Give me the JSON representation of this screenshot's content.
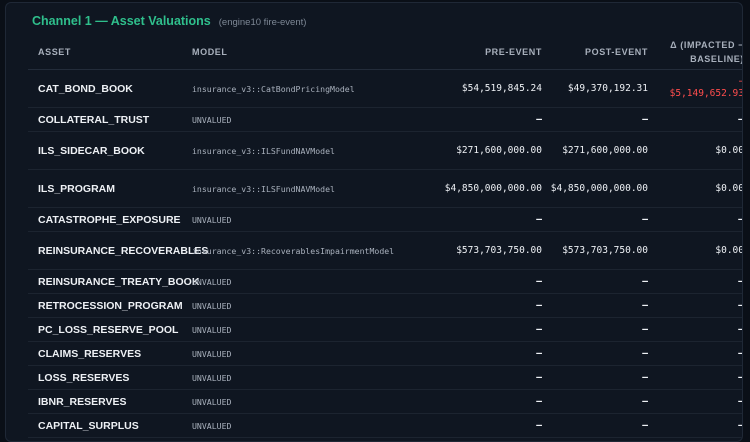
{
  "header": {
    "title": "Channel 1 — Asset Valuations",
    "subtitle": "(engine10 fire-event)"
  },
  "columns": {
    "asset": "ASSET",
    "model": "MODEL",
    "pre": "PRE-EVENT",
    "post": "POST-EVENT",
    "delta_line1": "Δ (IMPACTED −",
    "delta_line2": "BASELINE)"
  },
  "rows": [
    {
      "asset": "CAT_BOND_BOOK",
      "model": "insurance_v3::CatBondPricingModel",
      "pre": "$54,519,845.24",
      "post": "$49,370,192.31",
      "delta_prefix": "−",
      "delta": "$5,149,652.93",
      "negative": true
    },
    {
      "asset": "COLLATERAL_TRUST",
      "model": "UNVALUED",
      "pre": "—",
      "post": "—",
      "delta": "—"
    },
    {
      "asset": "ILS_SIDECAR_BOOK",
      "model": "insurance_v3::ILSFundNAVModel",
      "pre": "$271,600,000.00",
      "post": "$271,600,000.00",
      "delta": "$0.00"
    },
    {
      "asset": "ILS_PROGRAM",
      "model": "insurance_v3::ILSFundNAVModel",
      "pre": "$4,850,000,000.00",
      "post": "$4,850,000,000.00",
      "delta": "$0.00"
    },
    {
      "asset": "CATASTROPHE_EXPOSURE",
      "model": "UNVALUED",
      "pre": "—",
      "post": "—",
      "delta": "—"
    },
    {
      "asset": "REINSURANCE_RECOVERABLES",
      "model": "insurance_v3::RecoverablesImpairmentModel",
      "pre": "$573,703,750.00",
      "post": "$573,703,750.00",
      "delta": "$0.00"
    },
    {
      "asset": "REINSURANCE_TREATY_BOOK",
      "model": "UNVALUED",
      "pre": "—",
      "post": "—",
      "delta": "—"
    },
    {
      "asset": "RETROCESSION_PROGRAM",
      "model": "UNVALUED",
      "pre": "—",
      "post": "—",
      "delta": "—"
    },
    {
      "asset": "PC_LOSS_RESERVE_POOL",
      "model": "UNVALUED",
      "pre": "—",
      "post": "—",
      "delta": "—"
    },
    {
      "asset": "CLAIMS_RESERVES",
      "model": "UNVALUED",
      "pre": "—",
      "post": "—",
      "delta": "—"
    },
    {
      "asset": "LOSS_RESERVES",
      "model": "UNVALUED",
      "pre": "—",
      "post": "—",
      "delta": "—"
    },
    {
      "asset": "IBNR_RESERVES",
      "model": "UNVALUED",
      "pre": "—",
      "post": "—",
      "delta": "—"
    },
    {
      "asset": "CAPITAL_SURPLUS",
      "model": "UNVALUED",
      "pre": "—",
      "post": "—",
      "delta": "—"
    }
  ],
  "colors": {
    "accent": "#2fbf8c",
    "negative": "#ff4d4d"
  }
}
